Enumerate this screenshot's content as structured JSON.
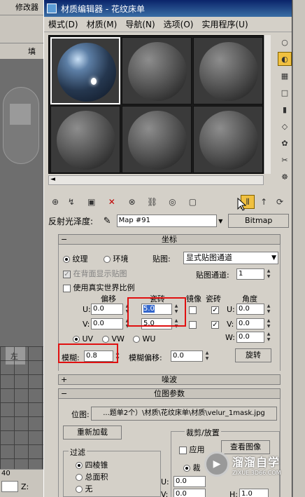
{
  "background": {
    "tab_label": "修改器",
    "side_label": "填",
    "viewport_label": "左",
    "bottom_num": "40",
    "z_label": "Z:"
  },
  "window": {
    "title": "材质编辑器 - 花纹床单",
    "menu": [
      "模式(D)",
      "材质(M)",
      "导航(N)",
      "选项(O)",
      "实用程序(U)"
    ]
  },
  "reflection": {
    "label": "反射光泽度:",
    "map_name": "Map #91",
    "map_type": "Bitmap"
  },
  "coords": {
    "header": "坐标",
    "texture_radio": "纹理",
    "env_radio": "环境",
    "mapping_label": "贴图:",
    "mapping_value": "显式贴图通道",
    "show_back": "在背面显示贴图",
    "map_channel_label": "贴图通道:",
    "map_channel_value": "1",
    "real_world": "使用真实世界比例",
    "offset_label": "偏移",
    "tiling_label": "瓷砖",
    "mirror_label": "镜像",
    "tile_label": "瓷砖",
    "angle_label": "角度",
    "u_label": "U:",
    "v_label": "V:",
    "w_label": "W:",
    "u_offset": "0.0",
    "v_offset": "0.0",
    "u_tiling": "5.0",
    "v_tiling": "5.0",
    "u_angle": "0.0",
    "v_angle": "0.0",
    "w_angle": "0.0",
    "uv": "UV",
    "vw": "VW",
    "wu": "WU",
    "blur_label": "模糊:",
    "blur_value": "0.8",
    "blur_offset_label": "模糊偏移:",
    "blur_offset_value": "0.0",
    "rotate_btn": "旋转"
  },
  "noise": {
    "header": "噪波"
  },
  "bitmap": {
    "header": "位图参数",
    "path_label": "位图:",
    "path_value": "...题单2个）\\材质\\花纹床单\\材质\\velur_1mask.jpg",
    "reload_btn": "重新加载",
    "crop_label": "裁剪/放置",
    "apply_label": "应用",
    "view_image_btn": "查看图像",
    "crop_radio": "裁",
    "u_label": "U:",
    "v_label": "V:",
    "u_value": "0.0",
    "v_value": "0.0",
    "h_label": "H:",
    "h_value": "1.0",
    "filter_label": "过滤",
    "filter_options": [
      "四棱锥",
      "总面积",
      "无"
    ]
  },
  "watermark": {
    "main": "溜溜自学",
    "sub": "ZIXUE.3D66.COM"
  }
}
